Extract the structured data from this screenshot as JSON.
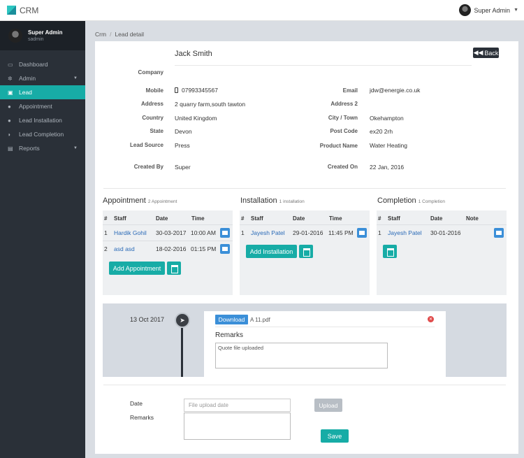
{
  "app": {
    "brand": "CRM",
    "user": "Super Admin"
  },
  "sidebar": {
    "user_name": "Super Admin",
    "user_role": "sadmin",
    "items": [
      {
        "label": "Dashboard",
        "icon": "laptop-icon"
      },
      {
        "label": "Admin",
        "icon": "gear-icon"
      },
      {
        "label": "Lead",
        "icon": "card-icon"
      },
      {
        "label": "Appointment",
        "icon": "globe-icon"
      },
      {
        "label": "Lead Installation",
        "icon": "info-icon"
      },
      {
        "label": "Lead Completion",
        "icon": "shield-icon"
      },
      {
        "label": "Reports",
        "icon": "table-icon"
      }
    ]
  },
  "breadcrumb": {
    "root": "Crm",
    "current": "Lead detail"
  },
  "lead": {
    "name": "Jack Smith",
    "back_label": "Back",
    "labels": {
      "company": "Company",
      "mobile": "Mobile",
      "address": "Address",
      "country": "Country",
      "state": "State",
      "lead_source": "Lead Source",
      "created_by": "Created By",
      "email": "Email",
      "address2": "Address 2",
      "city": "City / Town",
      "post_code": "Post Code",
      "product_name": "Product Name",
      "created_on": "Created On"
    },
    "values": {
      "company": "",
      "mobile": "07993345567",
      "address": "2 quarry farm,south tawton",
      "country": "United Kingdom",
      "state": "Devon",
      "lead_source": "Press",
      "created_by": "Super",
      "email": "jdw@energie.co.uk",
      "address2": "",
      "city": "Okehampton",
      "post_code": "ex20 2rh",
      "product_name": "Water Heating",
      "created_on": "22 Jan, 2016"
    }
  },
  "appointment": {
    "title": "Appointment",
    "count": "2 Appointment",
    "headers": [
      "#",
      "Staff",
      "Date",
      "Time"
    ],
    "rows": [
      {
        "n": "1",
        "staff": "Hardik Gohil",
        "date": "30-03-2017",
        "time": "10:00 AM"
      },
      {
        "n": "2",
        "staff": "asd asd",
        "date": "18-02-2016",
        "time": "01:15 PM"
      }
    ],
    "button": "Add Appointment"
  },
  "installation": {
    "title": "Installation",
    "count": "1 installation",
    "headers": [
      "#",
      "Staff",
      "Date",
      "Time"
    ],
    "rows": [
      {
        "n": "1",
        "staff": "Jayesh Patel",
        "date": "29-01-2016",
        "time": "11:45 PM"
      }
    ],
    "button": "Add Installation"
  },
  "completion": {
    "title": "Completion",
    "count": "1 Completion",
    "headers": [
      "#",
      "Staff",
      "Date",
      "Note"
    ],
    "rows": [
      {
        "n": "1",
        "staff": "Jayesh Patel",
        "date": "30-01-2016",
        "note": ""
      }
    ]
  },
  "timeline": {
    "date": "13 Oct 2017",
    "download": "Download",
    "file": "A 11.pdf",
    "remarks_label": "Remarks",
    "remarks_text": "Quote file uploaded"
  },
  "form": {
    "date_label": "Date",
    "date_placeholder": "File upload date",
    "remarks_label": "Remarks",
    "upload": "Upload",
    "save": "Save"
  }
}
